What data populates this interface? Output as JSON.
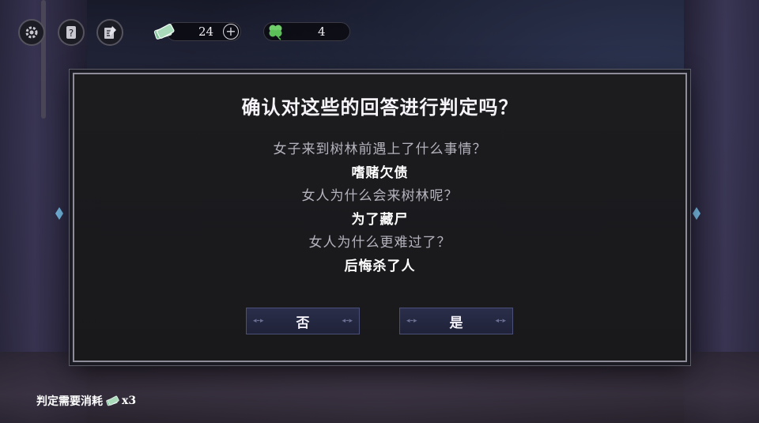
{
  "top_bar": {
    "settings_icon": "gear-icon",
    "help_icon": "question-card-icon",
    "notes_icon": "notebook-icon",
    "currency": {
      "icon": "bill-stack-icon",
      "value": "24",
      "add_icon": "plus-icon"
    },
    "clover": {
      "icon": "clover-icon",
      "value": "4"
    }
  },
  "dialog": {
    "title": "确认对这些的回答进行判定吗？",
    "items": [
      {
        "question": "女子来到树林前遇上了什么事情？",
        "answer": "嗜赌欠债"
      },
      {
        "question": "女人为什么会来树林呢？",
        "answer": "为了藏尸"
      },
      {
        "question": "女人为什么更难过了？",
        "answer": "后悔杀了人"
      }
    ],
    "no_label": "否",
    "yes_label": "是"
  },
  "footer": {
    "cost_text": "判定需要消耗",
    "cost_icon": "bill-stack-icon",
    "cost_amount": "x3"
  },
  "colors": {
    "accent": "#4a5078",
    "frame": "#8d8c98",
    "clover": "#6fd06a"
  }
}
